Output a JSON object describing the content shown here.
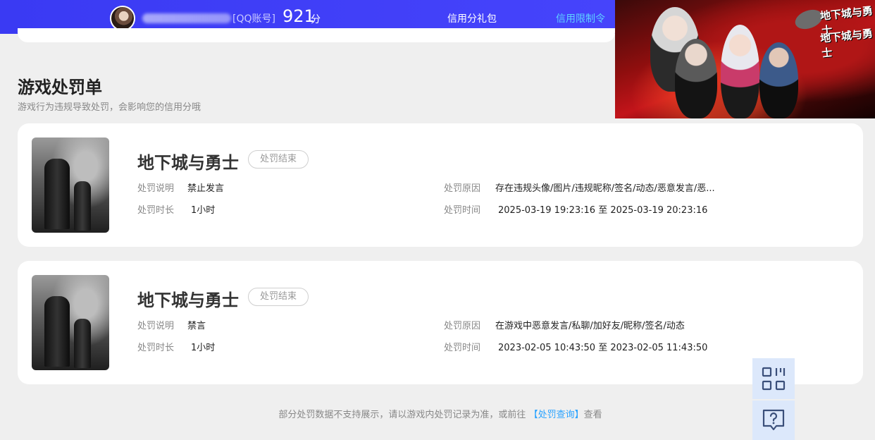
{
  "header": {
    "account_label": "[QQ账号]",
    "score": "921",
    "score_unit": "分",
    "nav": [
      {
        "label": "信用分礼包"
      },
      {
        "label": "信用限制令",
        "active": true
      }
    ],
    "accent_color": "#3b3cf6",
    "active_color": "#5fd2ff"
  },
  "banner": {
    "logo_text_1": "地下城与勇士",
    "logo_text_2": "地下城与勇士"
  },
  "section": {
    "title": "游戏处罚单",
    "subtitle": "游戏行为违规导致处罚，会影响您的信用分哦"
  },
  "penalties": [
    {
      "game": "地下城与勇士",
      "status": "处罚结束",
      "desc_label": "处罚说明",
      "desc": "禁止发言",
      "duration_label": "处罚时长",
      "duration": "1小时",
      "reason_label": "处罚原因",
      "reason": "存在违规头像/图片/违规昵称/签名/动态/恶意发言/恶...",
      "time_label": "处罚时间",
      "time": "2025-03-19 19:23:16 至 2025-03-19 20:23:16"
    },
    {
      "game": "地下城与勇士",
      "status": "处罚结束",
      "desc_label": "处罚说明",
      "desc": "禁言",
      "duration_label": "处罚时长",
      "duration": "1小时",
      "reason_label": "处罚原因",
      "reason": "在游戏中恶意发言/私聊/加好友/昵称/签名/动态",
      "time_label": "处罚时间",
      "time": "2023-02-05 10:43:50 至 2023-02-05 11:43:50"
    }
  ],
  "footer": {
    "prefix": "部分处罚数据不支持展示，请以游戏内处罚记录为准，或前往",
    "link": "【处罚查询】",
    "suffix": "查看"
  },
  "side": {
    "qr_icon": "qr-code-icon",
    "help_icon": "help-chat-icon"
  }
}
